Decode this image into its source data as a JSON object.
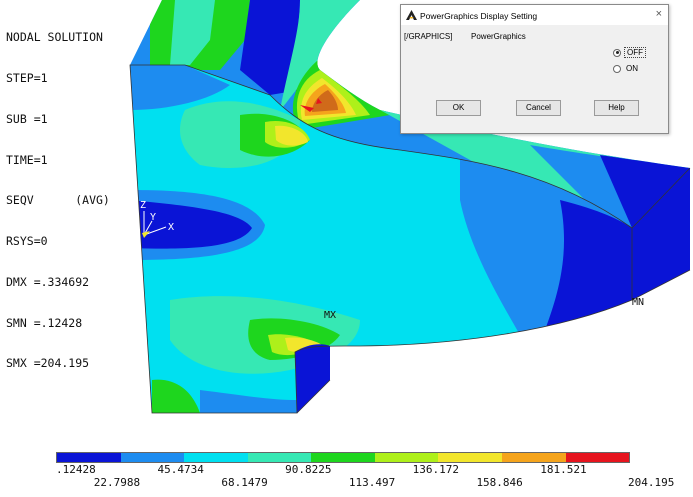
{
  "plot": {
    "title": "NODAL SOLUTION",
    "lines": [
      "STEP=1",
      "SUB =1",
      "TIME=1",
      "SEQV      (AVG)",
      "RSYS=0",
      "DMX =.334692",
      "SMN =.12428",
      "SMX =204.195"
    ],
    "mx_label": "MX",
    "mn_label": "MN",
    "triad": {
      "z": "Z",
      "y": "Y",
      "x": "X"
    }
  },
  "legend": {
    "colors": [
      "#0a14d6",
      "#1d8cf0",
      "#00e0f0",
      "#36e8b4",
      "#1ed61e",
      "#aef01a",
      "#f2e62c",
      "#f5a41c",
      "#e6141e"
    ],
    "values_top": [
      ".12428",
      "45.4734",
      "90.8225",
      "136.172",
      "181.521"
    ],
    "values_bottom": [
      "22.7988",
      "68.1479",
      "113.497",
      "158.846",
      "204.195"
    ]
  },
  "dialog": {
    "title": "PowerGraphics Display Setting",
    "close": "×",
    "command": "[/GRAPHICS]",
    "label": "PowerGraphics",
    "options": [
      {
        "label": "OFF",
        "selected": true
      },
      {
        "label": "ON",
        "selected": false
      }
    ],
    "buttons": {
      "ok": "OK",
      "cancel": "Cancel",
      "help": "Help"
    }
  }
}
